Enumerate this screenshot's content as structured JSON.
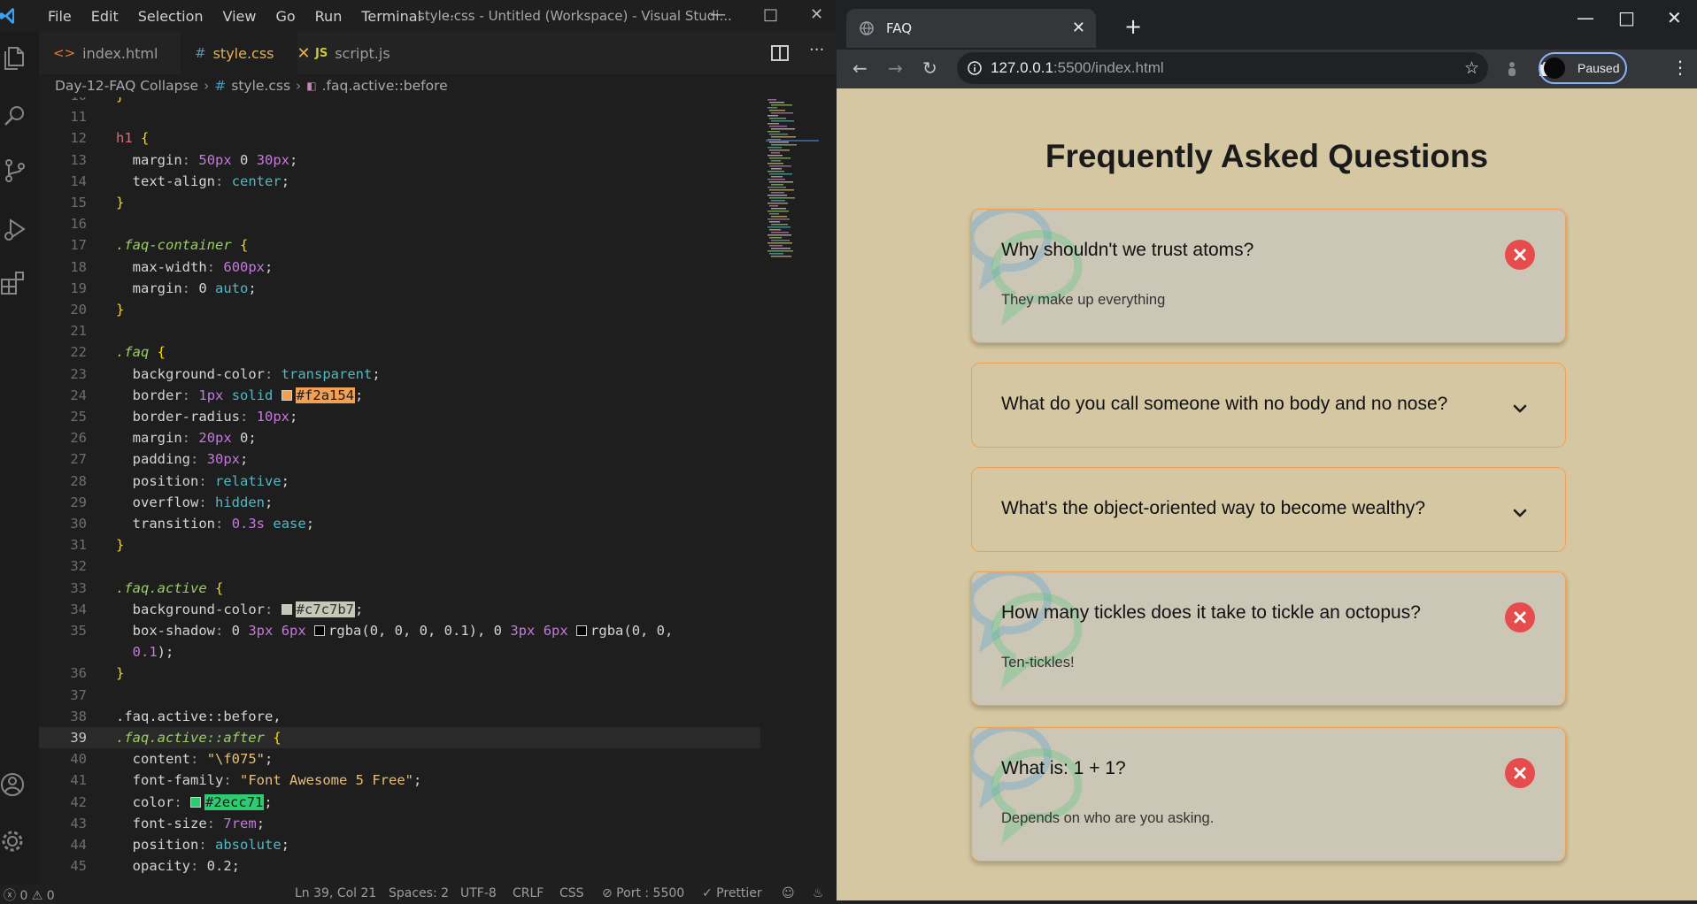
{
  "vscode": {
    "menu": [
      "File",
      "Edit",
      "Selection",
      "View",
      "Go",
      "Run",
      "Terminal",
      "···"
    ],
    "window_title": "style.css - Untitled (Workspace) - Visual Studi...",
    "tabs": [
      {
        "label": "index.html",
        "icon": "<>"
      },
      {
        "label": "style.css",
        "icon": "#"
      },
      {
        "label": "script.js",
        "icon": "JS"
      }
    ],
    "breadcrumb": [
      "Day-12-FAQ Collapse",
      "style.css",
      ".faq.active::before"
    ],
    "current_line": 39,
    "status": {
      "problems": "ⓧ 0 ⚠ 0",
      "position": "Ln 39, Col 21",
      "spaces": "Spaces: 2",
      "encoding": "UTF-8",
      "eol": "CRLF",
      "language": "CSS",
      "port": "⊘ Port : 5500",
      "prettier": "✓ Prettier"
    },
    "lines": [
      {
        "n": "10",
        "code": "}"
      },
      {
        "n": "11",
        "code": ""
      },
      {
        "n": "12",
        "code": "h1 {"
      },
      {
        "n": "13",
        "code": "  margin: 50px 0 30px;"
      },
      {
        "n": "14",
        "code": "  text-align: center;"
      },
      {
        "n": "15",
        "code": "}"
      },
      {
        "n": "16",
        "code": ""
      },
      {
        "n": "17",
        "code": ".faq-container {"
      },
      {
        "n": "18",
        "code": "  max-width: 600px;"
      },
      {
        "n": "19",
        "code": "  margin: 0 auto;"
      },
      {
        "n": "20",
        "code": "}"
      },
      {
        "n": "21",
        "code": ""
      },
      {
        "n": "22",
        "code": ".faq {"
      },
      {
        "n": "23",
        "code": "  background-color: transparent;"
      },
      {
        "n": "24",
        "code": "  border: 1px solid #f2a154;"
      },
      {
        "n": "25",
        "code": "  border-radius: 10px;"
      },
      {
        "n": "26",
        "code": "  margin: 20px 0;"
      },
      {
        "n": "27",
        "code": "  padding: 30px;"
      },
      {
        "n": "28",
        "code": "  position: relative;"
      },
      {
        "n": "29",
        "code": "  overflow: hidden;"
      },
      {
        "n": "30",
        "code": "  transition: 0.3s ease;"
      },
      {
        "n": "31",
        "code": "}"
      },
      {
        "n": "32",
        "code": ""
      },
      {
        "n": "33",
        "code": ".faq.active {"
      },
      {
        "n": "34",
        "code": "  background-color: #c7c7b7;"
      },
      {
        "n": "35",
        "code": "  box-shadow: 0 3px 6px rgba(0, 0, 0, 0.1), 0 3px 6px rgba(0, 0,"
      },
      {
        "n": "",
        "code": "  0.1);"
      },
      {
        "n": "36",
        "code": "}"
      },
      {
        "n": "37",
        "code": ""
      },
      {
        "n": "38",
        "code": ".faq.active::before,"
      },
      {
        "n": "39",
        "code": ".faq.active::after {"
      },
      {
        "n": "40",
        "code": "  content: \"\\f075\";"
      },
      {
        "n": "41",
        "code": "  font-family: \"Font Awesome 5 Free\";"
      },
      {
        "n": "42",
        "code": "  color: #2ecc71;"
      },
      {
        "n": "43",
        "code": "  font-size: 7rem;"
      },
      {
        "n": "44",
        "code": "  position: absolute;"
      },
      {
        "n": "45",
        "code": "  opacity: 0.2;"
      }
    ]
  },
  "browser": {
    "tab_title": "FAQ",
    "url_host": "127.0.0.1",
    "url_rest": ":5500/index.html",
    "profile_label": "Paused",
    "page": {
      "title": "Frequently Asked Questions",
      "faqs": [
        {
          "question": "Why shouldn't we trust atoms?",
          "answer": "They make up everything",
          "active": true
        },
        {
          "question": "What do you call someone with no body and no nose?",
          "answer": "",
          "active": false
        },
        {
          "question": "What's the object-oriented way to become wealthy?",
          "answer": "",
          "active": false
        },
        {
          "question": "How many tickles does it take to tickle an octopus?",
          "answer": "Ten-tickles!",
          "active": true
        },
        {
          "question": "What is: 1 + 1?",
          "answer": "Depends on who are you asking.",
          "active": true
        }
      ]
    },
    "colors": {
      "page_bg": "#d4c7a1",
      "border": "#f2a154",
      "active_bg": "#c7c7b7",
      "close_btn": "#e74c4c",
      "bubble_green": "#2ecc71",
      "bubble_blue": "#3498db"
    }
  }
}
